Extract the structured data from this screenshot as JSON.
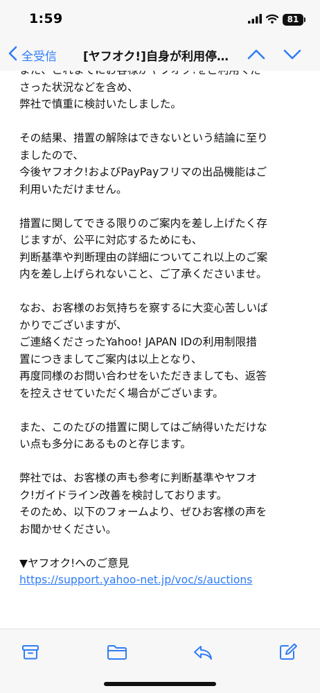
{
  "status_bar": {
    "time": "1:59",
    "battery": "81",
    "icons": [
      "cellular-signal-icon",
      "wifi-icon",
      "battery-icon"
    ]
  },
  "nav": {
    "back_label": "全受信",
    "title": "[ヤフオク!]自身が利用停止…",
    "icons": [
      "chevron-left-icon",
      "chevron-up-icon",
      "chevron-down-icon"
    ]
  },
  "body": {
    "paragraphs": [
      {
        "lines": [
          "また、これまでにお客様がヤフオク!をご利用くだ",
          "さった状況などを含め、",
          "弊社で慎重に検討いたしました。"
        ]
      },
      {
        "lines": [
          "その結果、措置の解除はできないという結論に至り",
          "ましたので、",
          "今後ヤフオク!およびPayPayフリマの出品機能はご",
          "利用いただけません。"
        ]
      },
      {
        "lines": [
          "措置に関してできる限りのご案内を差し上げたく存",
          "じますが、公平に対応するためにも、",
          "判断基準や判断理由の詳細についてこれ以上のご案",
          "内を差し上げられないこと、ご了承くださいませ。"
        ]
      },
      {
        "lines": [
          "なお、お客様のお気持ちを察するに大変心苦しいば",
          "かりでございますが、",
          "ご連絡くださったYahoo! JAPAN IDの利用制限措",
          "置につきましてご案内は以上となり、",
          "再度同様のお問い合わせをいただきましても、返答",
          "を控えさせていただく場合がございます。"
        ]
      },
      {
        "lines": [
          "また、このたびの措置に関してはご納得いただけな",
          "い点も多分にあるものと存じます。"
        ]
      },
      {
        "lines": [
          "弊社では、お客様の声も参考に判断基準やヤフオ",
          "ク!ガイドライン改善を検討しております。",
          "そのため、以下のフォームより、ぜひお客様の声を",
          "お聞かせください。"
        ]
      },
      {
        "lines": [
          "▼ヤフオク!へのご意見"
        ]
      }
    ],
    "link": "https://support.yahoo-net.jp/voc/s/auctions"
  },
  "toolbar": {
    "icons": [
      "archive-icon",
      "folder-icon",
      "reply-icon",
      "compose-icon"
    ]
  },
  "colors": {
    "accent": "#2f7cf6",
    "bar_background": "#f7f7f8",
    "text": "#111111"
  }
}
